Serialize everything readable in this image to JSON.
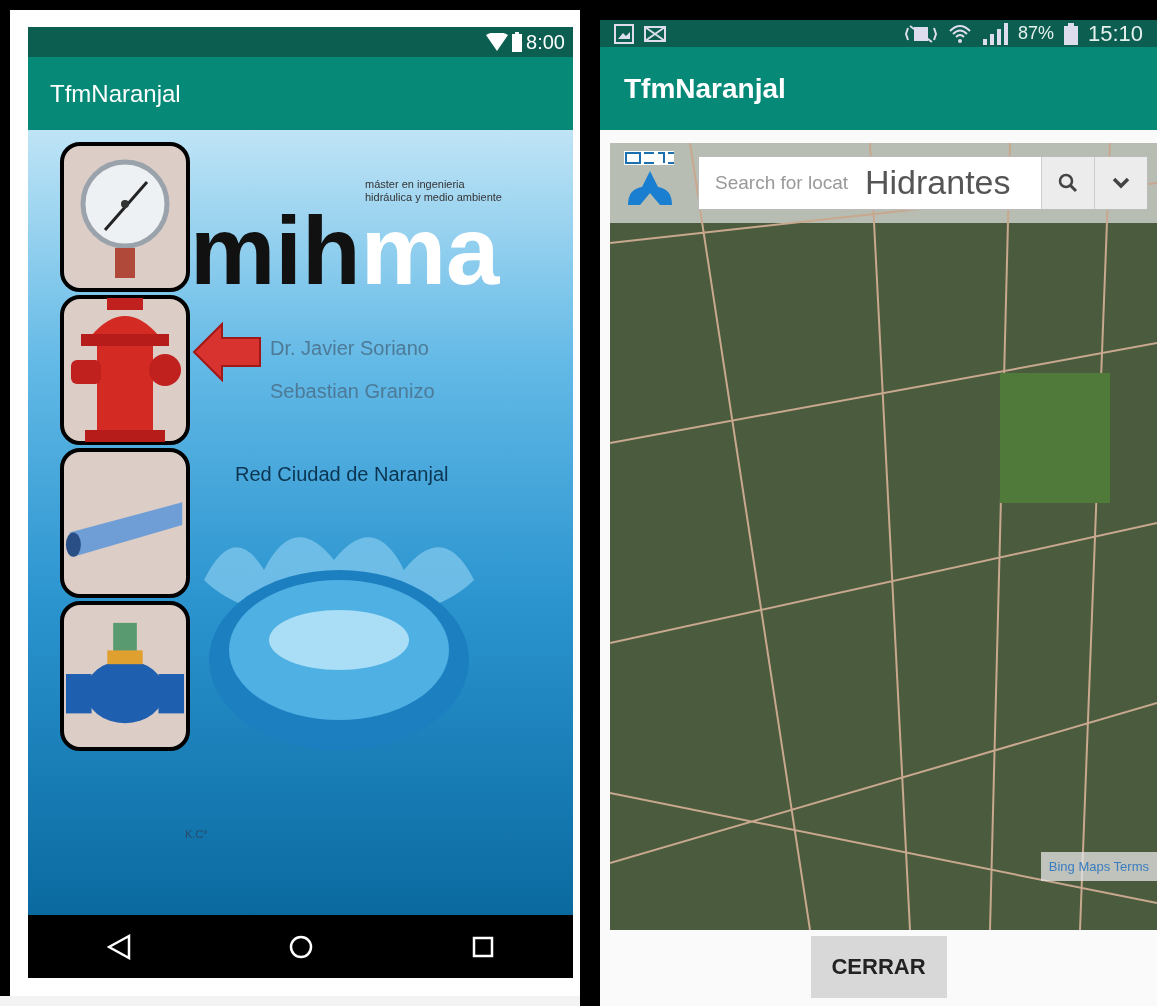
{
  "left_screen": {
    "status_bar": {
      "time": "8:00"
    },
    "app_bar": {
      "title": "TfmNaranjal"
    },
    "splash": {
      "logo": {
        "dark_part": "mih",
        "light_part": "ma",
        "tagline_1": "máster en ingenieria",
        "tagline_2": "hidráulica y medio ambiente"
      },
      "tiles": [
        {
          "kind": "gauge"
        },
        {
          "kind": "hydrant"
        },
        {
          "kind": "pipe"
        },
        {
          "kind": "valve"
        }
      ],
      "credits": [
        "Dr. Javier Soriano",
        "Sebastian Granizo"
      ],
      "subtitle": "Red Ciudad de Naranjal",
      "signature": "K.C°"
    }
  },
  "right_screen": {
    "status_bar": {
      "battery": "87%",
      "time": "15:10"
    },
    "app_bar": {
      "title": "TfmNaranjal"
    },
    "map": {
      "search": {
        "placeholder": "Search for locat"
      },
      "title": "Hidrantes",
      "attribution": "Bing Maps Terms"
    },
    "button": "CERRAR"
  }
}
